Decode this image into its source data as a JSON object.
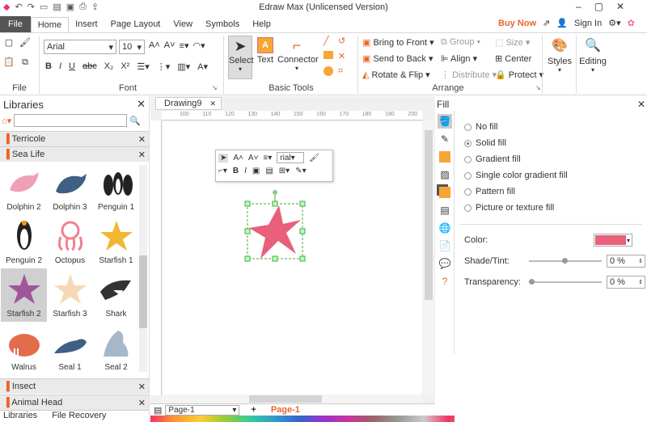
{
  "app": {
    "title": "Edraw Max (Unlicensed Version)"
  },
  "menu": {
    "tabs": [
      "File",
      "Home",
      "Insert",
      "Page Layout",
      "View",
      "Symbols",
      "Help"
    ],
    "buy_now": "Buy Now",
    "sign_in": "Sign In"
  },
  "ribbon": {
    "file_group": "File",
    "font": {
      "name": "Arial",
      "size": "10",
      "group": "Font"
    },
    "tools": {
      "select": "Select",
      "text": "Text",
      "connector": "Connector",
      "group": "Basic Tools"
    },
    "arrange": {
      "bring_front": "Bring to Front",
      "send_back": "Send to Back",
      "rotate_flip": "Rotate & Flip",
      "group_btn": "Group",
      "align": "Align",
      "distribute": "Distribute",
      "size": "Size",
      "center": "Center",
      "protect": "Protect",
      "group": "Arrange"
    },
    "styles": "Styles",
    "editing": "Editing"
  },
  "libraries": {
    "title": "Libraries",
    "search_placeholder": "",
    "categories": {
      "terricole": "Terricole",
      "sea_life": "Sea Life",
      "insect": "Insect",
      "animal_head": "Animal Head"
    },
    "shapes": [
      {
        "label": "Dolphin 2"
      },
      {
        "label": "Dolphin 3"
      },
      {
        "label": "Penguin 1"
      },
      {
        "label": "Penguin 2"
      },
      {
        "label": "Octopus"
      },
      {
        "label": "Starfish 1"
      },
      {
        "label": "Starfish 2"
      },
      {
        "label": "Starfish 3"
      },
      {
        "label": "Shark"
      },
      {
        "label": "Walrus"
      },
      {
        "label": "Seal 1"
      },
      {
        "label": "Seal 2"
      }
    ],
    "bottom_tabs": [
      "Libraries",
      "File Recovery"
    ]
  },
  "document": {
    "tab": "Drawing9",
    "ruler": [
      "100",
      "110",
      "120",
      "130",
      "140",
      "150",
      "160",
      "170",
      "180",
      "190",
      "200"
    ],
    "floating_font": "rial"
  },
  "pages": {
    "current": "Page-1",
    "tab": "Page-1"
  },
  "fill": {
    "title": "Fill",
    "options": [
      "No fill",
      "Solid fill",
      "Gradient fill",
      "Single color gradient fill",
      "Pattern fill",
      "Picture or texture fill"
    ],
    "selected": "Solid fill",
    "color_label": "Color:",
    "color": "#e8607a",
    "shade_label": "Shade/Tint:",
    "shade_value": "0 %",
    "transparency_label": "Transparency:",
    "transparency_value": "0 %"
  },
  "colors": {
    "accent": "#e8662b",
    "starfish": "#e8607a"
  }
}
